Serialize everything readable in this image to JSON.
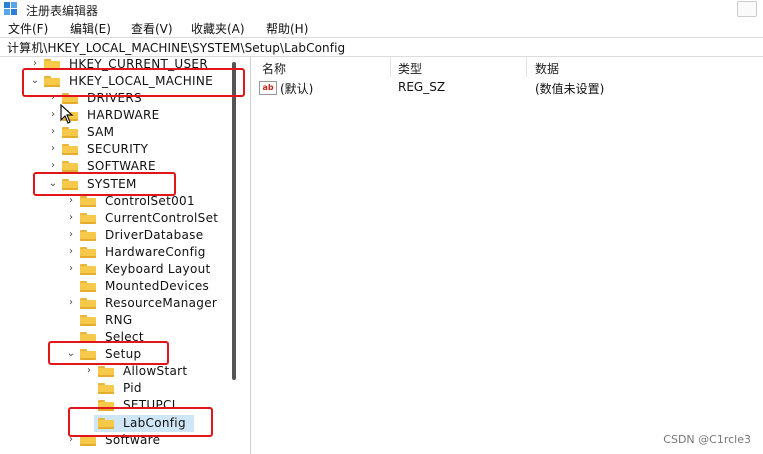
{
  "window": {
    "title": "注册表编辑器"
  },
  "menu": [
    "文件(F)",
    "编辑(E)",
    "查看(V)",
    "收藏夹(A)",
    "帮助(H)"
  ],
  "address": "计算机\\HKEY_LOCAL_MACHINE\\SYSTEM\\Setup\\LabConfig",
  "tree": {
    "hkcu": "HKEY_CURRENT_USER",
    "hklm": "HKEY_LOCAL_MACHINE",
    "drivers": "DRIVERS",
    "hardware": "HARDWARE",
    "sam": "SAM",
    "security": "SECURITY",
    "software": "SOFTWARE",
    "system": "SYSTEM",
    "controlset001": "ControlSet001",
    "currentcontrolset": "CurrentControlSet",
    "driverdatabase": "DriverDatabase",
    "hardwareconfig": "HardwareConfig",
    "keyboardlayout": "Keyboard Layout",
    "mounteddevices": "MountedDevices",
    "resourcemanager": "ResourceManager",
    "rng": "RNG",
    "select": "Select",
    "setup": "Setup",
    "allowstart": "AllowStart",
    "pid": "Pid",
    "setupcl": "SETUPCL",
    "labconfig": "LabConfig",
    "software2": "Software"
  },
  "columns": {
    "name": "名称",
    "type": "类型",
    "data": "数据"
  },
  "values": [
    {
      "icon": "ab",
      "name": "(默认)",
      "type": "REG_SZ",
      "data": "(数值未设置)"
    }
  ],
  "watermark": "CSDN @C1rcle3",
  "colors": {
    "highlight": "#e0161b",
    "selection": "#cfe6f7",
    "folder": "#f6c94a"
  }
}
